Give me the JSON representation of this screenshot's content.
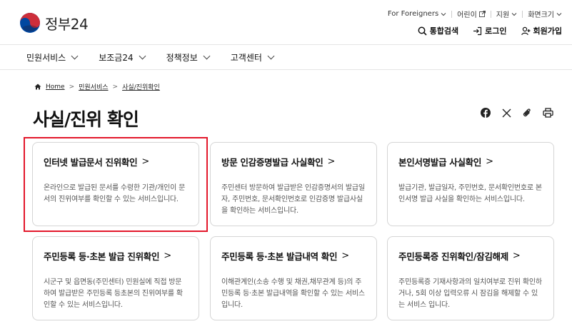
{
  "logo": {
    "text": "정부24"
  },
  "util_nav": [
    {
      "label": "For Foreigners",
      "icon": "chevron-down-icon"
    },
    {
      "label": "어린이",
      "icon": "external-link-icon"
    },
    {
      "label": "지원",
      "icon": "chevron-down-icon"
    },
    {
      "label": "화면크기",
      "icon": "chevron-down-icon"
    }
  ],
  "user_nav": [
    {
      "label": "통합검색",
      "icon": "search-icon"
    },
    {
      "label": "로그인",
      "icon": "login-icon"
    },
    {
      "label": "회원가입",
      "icon": "user-plus-icon"
    }
  ],
  "gnb": [
    "민원서비스",
    "보조금24",
    "정책정보",
    "고객센터"
  ],
  "breadcrumb": {
    "home": "Home",
    "level1": "민원서비스",
    "level2": "사실/진위확인"
  },
  "page_title": "사실/진위 확인",
  "share_icons": [
    "facebook-icon",
    "x-icon",
    "link-icon",
    "print-icon"
  ],
  "cards": [
    {
      "title": "인터넷 발급문서 진위확인",
      "desc": "온라인으로 발급된 문서를 수령한 기관/개인이 문서의 진위여부를 확인할 수 있는 서비스입니다."
    },
    {
      "title": "방문 인감증명발급 사실확인",
      "desc": "주민센터 방문하여 발급받은 인감증명서의 발급일자, 주민번호, 문서확인번호로 인감증명 발급사실을 확인하는 서비스입니다."
    },
    {
      "title": "본인서명발급 사실확인",
      "desc": "발급기관, 발급일자, 주민번호, 문서확인번호로 본인서명 발급 사실을 확인하는 서비스입니다."
    },
    {
      "title": "주민등록 등·초본 발급 진위확인",
      "desc": "시군구 및 읍면동(주민센터) 민원실에 직접 방문하여 발급받은 주민등록 등초본의 진위여부를 확인할 수 있는 서비스입니다."
    },
    {
      "title": "주민등록 등·초본 발급내역 확인",
      "desc": "이해관계인(소송 수행 및 채권,채무관계 등)의 주민등록 등·초본 발급내역을 확인할 수 있는 서비스입니다."
    },
    {
      "title": "주민등록증 진위확인/잠김해제",
      "desc": "주민등록증 기재사항과의 일치여부로 진위 확인하거나, 5회 이상 입력오류 시 잠김을 해제할 수 있는 서비스 입니다."
    }
  ],
  "card_arrow": ">",
  "breadcrumb_sep": ">",
  "colors": {
    "highlight": "#e3182b",
    "taeguk_red": "#cd2e3a",
    "taeguk_blue": "#0047a0"
  }
}
